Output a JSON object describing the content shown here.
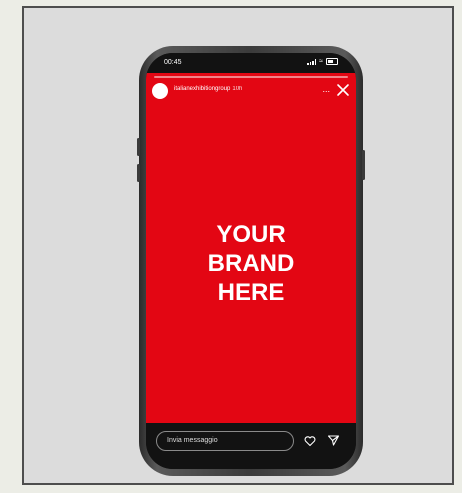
{
  "status": {
    "time": "00:45"
  },
  "story": {
    "username": "italianexhibitiongroup",
    "age": "10h",
    "more_label": "...",
    "brand_lines": [
      "YOUR",
      "BRAND",
      "HERE"
    ]
  },
  "reply": {
    "placeholder": "Invia messaggio"
  },
  "colors": {
    "story_bg": "#e30613",
    "phone_frame": "#3b3b3b",
    "backdrop": "#dcdcdc"
  },
  "icons": {
    "close": "close-icon",
    "like": "heart-icon",
    "send": "send-icon"
  }
}
